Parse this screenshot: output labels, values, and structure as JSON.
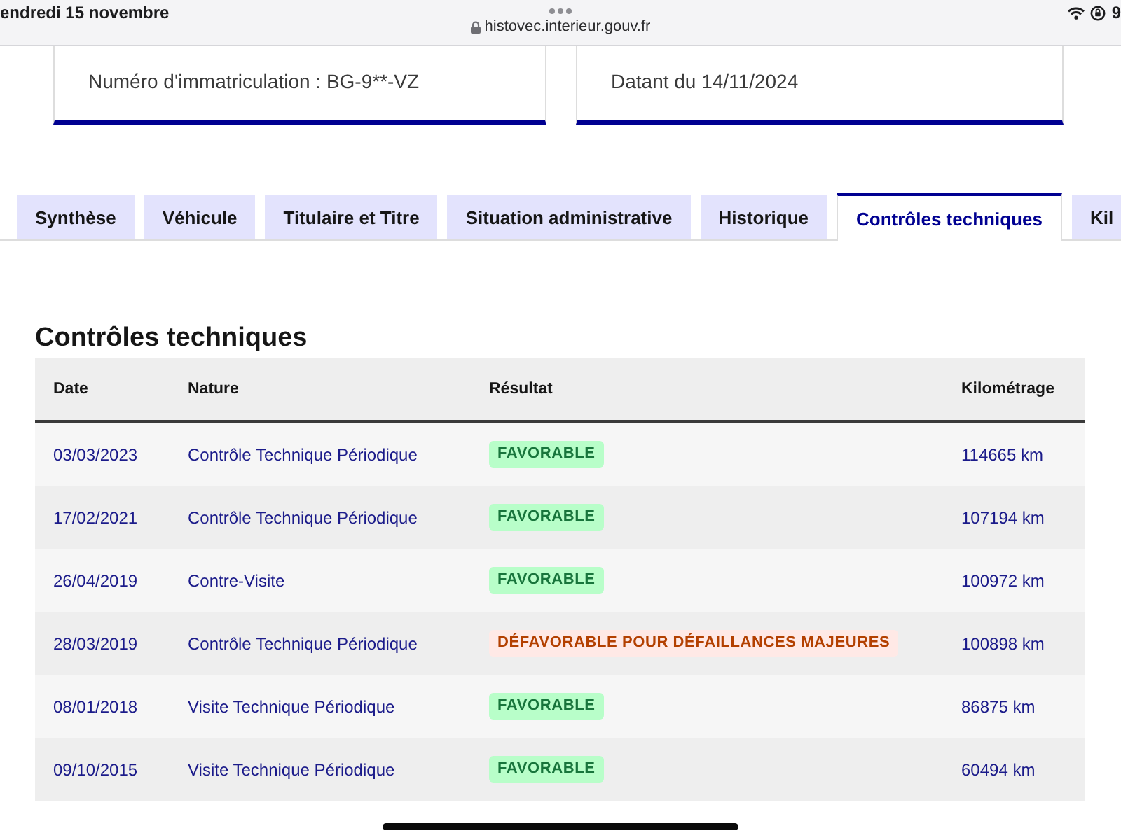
{
  "status_bar": {
    "date": "endredi 15 novembre",
    "url": "histovec.interieur.gouv.fr",
    "battery": "9"
  },
  "info_cards": [
    {
      "text": "Numéro d'immatriculation : BG-9**-VZ"
    },
    {
      "text": "Datant du 14/11/2024"
    }
  ],
  "tabs": [
    {
      "label": "Synthèse",
      "selected": false
    },
    {
      "label": "Véhicule",
      "selected": false
    },
    {
      "label": "Titulaire et Titre",
      "selected": false
    },
    {
      "label": "Situation administrative",
      "selected": false
    },
    {
      "label": "Historique",
      "selected": false
    },
    {
      "label": "Contrôles techniques",
      "selected": true
    },
    {
      "label": "Kil",
      "selected": false
    }
  ],
  "section": {
    "title": "Contrôles techniques",
    "table": {
      "columns": [
        "Date",
        "Nature",
        "Résultat",
        "Kilométrage"
      ],
      "rows": [
        {
          "date": "03/03/2023",
          "nature": "Contrôle Technique Périodique",
          "result": {
            "label": "FAVORABLE",
            "kind": "favorable"
          },
          "mileage": "114665 km"
        },
        {
          "date": "17/02/2021",
          "nature": "Contrôle Technique Périodique",
          "result": {
            "label": "FAVORABLE",
            "kind": "favorable"
          },
          "mileage": "107194 km"
        },
        {
          "date": "26/04/2019",
          "nature": "Contre-Visite",
          "result": {
            "label": "FAVORABLE",
            "kind": "favorable"
          },
          "mileage": "100972 km"
        },
        {
          "date": "28/03/2019",
          "nature": "Contrôle Technique Périodique",
          "result": {
            "label": "DÉFAVORABLE POUR DÉFAILLANCES MAJEURES",
            "kind": "unfavorable"
          },
          "mileage": "100898 km"
        },
        {
          "date": "08/01/2018",
          "nature": "Visite Technique Périodique",
          "result": {
            "label": "FAVORABLE",
            "kind": "favorable"
          },
          "mileage": "86875 km"
        },
        {
          "date": "09/10/2015",
          "nature": "Visite Technique Périodique",
          "result": {
            "label": "FAVORABLE",
            "kind": "favorable"
          },
          "mileage": "60494 km"
        }
      ]
    }
  }
}
